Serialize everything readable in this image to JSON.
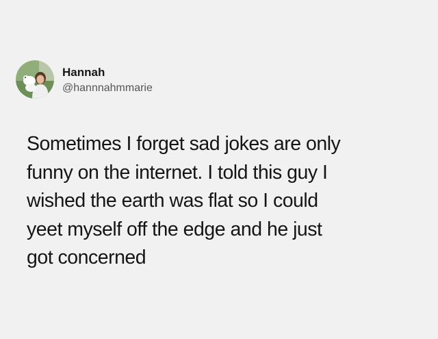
{
  "tweet": {
    "author": {
      "display_name": "Hannah",
      "handle": "@hannnahmmarie",
      "avatar_icon": "profile-photo-avatar"
    },
    "text_lines": [
      "Sometimes I forget sad jokes are only",
      "funny on the internet. I told this guy I",
      "wished the earth was flat so I could",
      "yeet myself off the edge and he just",
      "got concerned"
    ]
  },
  "colors": {
    "background": "#f1f1f1",
    "text": "#151515",
    "handle": "#555555"
  }
}
